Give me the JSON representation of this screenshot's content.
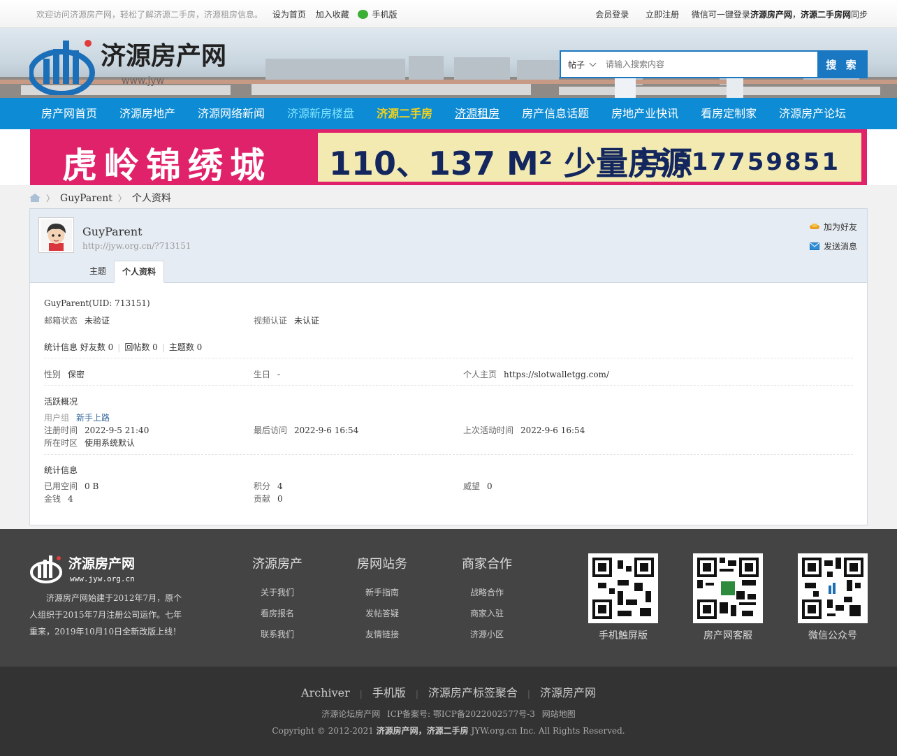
{
  "topbar": {
    "welcome": "欢迎访问济源房产网，轻松了解济源二手房，济源租房信息。",
    "set_home": "设为首页",
    "add_fav": "加入收藏",
    "mobile": "手机版",
    "login": "会员登录",
    "register": "立即注册",
    "wechat_prefix": "微信可一键登录",
    "wechat_site1": "济源房产网",
    "wechat_comma": "，",
    "wechat_site2": "济源二手房网",
    "wechat_suffix": "同步"
  },
  "header": {
    "logo_text": "济源房产网",
    "logo_sub": "www.jyw",
    "search_category": "帖子",
    "search_placeholder": "请输入搜索内容",
    "search_button": "搜 索"
  },
  "nav": {
    "items": [
      {
        "label": "房产网首页"
      },
      {
        "label": "济源房地产"
      },
      {
        "label": "济源网络新闻"
      },
      {
        "label": "济源新房楼盘"
      },
      {
        "label": "济源二手房"
      },
      {
        "label": "济源租房"
      },
      {
        "label": "房产信息话题"
      },
      {
        "label": "房地产业快讯"
      },
      {
        "label": "看房定制家"
      },
      {
        "label": "济源房产论坛"
      }
    ]
  },
  "banner": {
    "name": "虎岭锦绣城",
    "sizes": "110、137 M² 少量房源",
    "phone": "15517759851"
  },
  "breadcrumb": {
    "user": "GuyParent",
    "sep": "〉",
    "page": "个人资料"
  },
  "profile": {
    "username": "GuyParent",
    "url": "http://jyw.org.cn/?713151",
    "add_friend": "加为好友",
    "send_message": "发送消息",
    "tabs": [
      {
        "label": "主题"
      },
      {
        "label": "个人资料"
      }
    ],
    "uid_line": "GuyParent(UID: 713151)",
    "email_label": "邮箱状态",
    "email_value": "未验证",
    "video_label": "视频认证",
    "video_value": "未认证",
    "stats_label": "统计信息",
    "friends": "好友数 0",
    "replies": "回帖数 0",
    "threads": "主题数 0",
    "gender_label": "性别",
    "gender_value": "保密",
    "birthday_label": "生日",
    "birthday_value": "-",
    "homepage_label": "个人主页",
    "homepage_value": "https://slotwalletgg.com/",
    "activity_title": "活跃概况",
    "group_label": "用户组",
    "group_value": "新手上路",
    "reg_label": "注册时间",
    "reg_value": "2022-9-5 21:40",
    "last_visit_label": "最后访问",
    "last_visit_value": "2022-9-6 16:54",
    "last_active_label": "上次活动时间",
    "last_active_value": "2022-9-6 16:54",
    "tz_label": "所在时区",
    "tz_value": "使用系统默认",
    "stats_title": "统计信息",
    "space_label": "已用空间",
    "space_value": "0 B",
    "points_label": "积分",
    "points_value": "4",
    "prestige_label": "威望",
    "prestige_value": "0",
    "money_label": "金钱",
    "money_value": "4",
    "contrib_label": "贡献",
    "contrib_value": "0"
  },
  "footer": {
    "logo_text": "济源房产网",
    "logo_url": "www.jyw.org.cn",
    "intro": "济源房产网始建于2012年7月，原个人组织于2015年7月注册公司运作。七年重来，2019年10月10日全新改版上线！",
    "columns": [
      {
        "title": "济源房产",
        "links": [
          "关于我们",
          "看房报名",
          "联系我们"
        ]
      },
      {
        "title": "房网站务",
        "links": [
          "新手指南",
          "发帖答疑",
          "友情链接"
        ]
      },
      {
        "title": "商家合作",
        "links": [
          "战略合作",
          "商家入驻",
          "济源小区"
        ]
      }
    ],
    "qr": [
      {
        "caption": "手机触屏版"
      },
      {
        "caption": "房产网客服"
      },
      {
        "caption": "微信公众号"
      }
    ]
  },
  "bottom": {
    "links": [
      "Archiver",
      "手机版",
      "济源房产标签聚合",
      "济源房产网"
    ],
    "sep": "|",
    "icp_site": "济源论坛房产网",
    "icp": "ICP备案号: 鄂ICP备2022002577号-3",
    "sitemap": "网站地图",
    "copy_prefix": "Copyright © 2012-2021",
    "copy_bold": "济源房产网，济源二手房",
    "copy_suffix": "JYW.org.cn Inc. All Rights Reserved."
  },
  "colors": {
    "nav_bg": "#0d8bd4",
    "search_accent": "#1a78c2",
    "banner_pink": "#e0226b",
    "banner_yellow": "#f3eab2",
    "footer_bg": "#444444"
  }
}
